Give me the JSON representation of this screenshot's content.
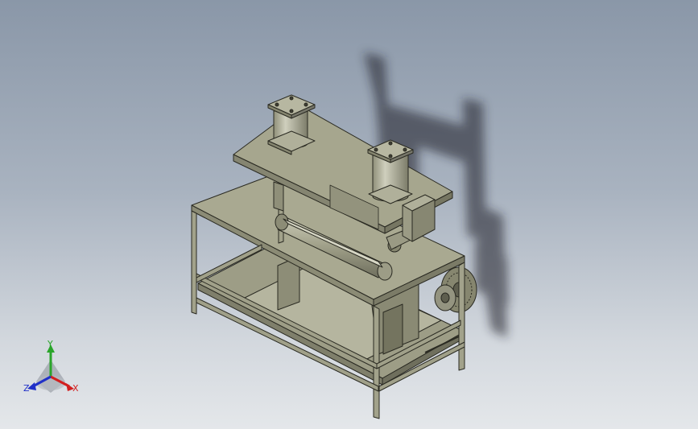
{
  "viewport": {
    "scene": "machine-assembly-isometric",
    "background_top": "#8a97a8",
    "background_bottom": "#e4e7ea",
    "part_color": "#a3a38b",
    "edge_color": "#2a2a22"
  },
  "triad": {
    "x_label": "X",
    "y_label": "Y",
    "z_label": "Z",
    "x_color": "#d21f1f",
    "y_color": "#2aa52a",
    "z_color": "#2030c8"
  }
}
